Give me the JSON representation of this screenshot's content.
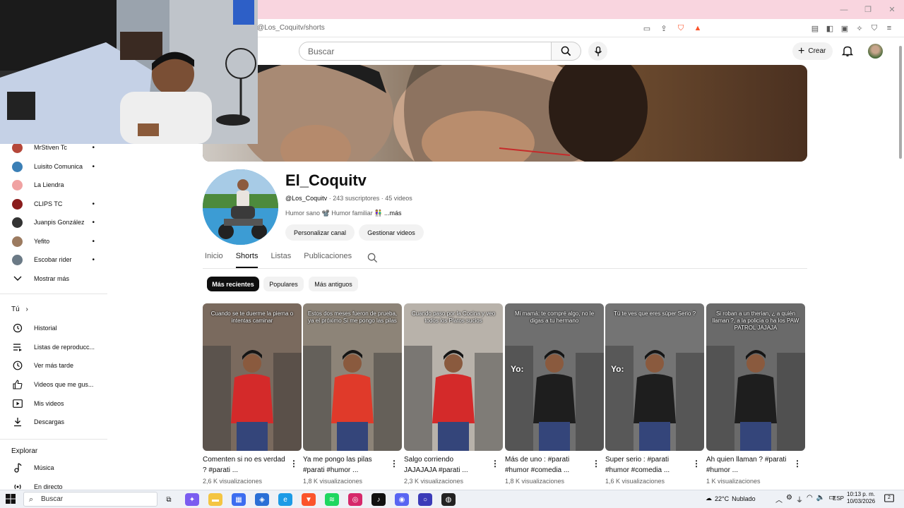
{
  "browser": {
    "url": "@Los_Coquitv/shorts"
  },
  "header": {
    "search_placeholder": "Buscar",
    "create_label": "Crear"
  },
  "sidebar": {
    "subscriptions": [
      {
        "name": "MrStiven Tc",
        "color": "#b5473a",
        "dot": "•"
      },
      {
        "name": "Luisito Comunica",
        "color": "#3b7fb6",
        "dot": "•"
      },
      {
        "name": "La Liendra",
        "color": "#f0a2a2",
        "dot": ""
      },
      {
        "name": "CLIPS TC",
        "color": "#8a1d1d",
        "dot": "•"
      },
      {
        "name": "Juanpis González",
        "color": "#333333",
        "dot": "•"
      },
      {
        "name": "Yefito",
        "color": "#9c7b60",
        "dot": "•"
      },
      {
        "name": "Escobar rider",
        "color": "#6b7a86",
        "dot": "•"
      }
    ],
    "show_more": "Mostrar más",
    "you_label": "Tú",
    "you_items": [
      {
        "label": "Historial",
        "icon": "history-icon"
      },
      {
        "label": "Listas de reproducc...",
        "icon": "playlists-icon"
      },
      {
        "label": "Ver más tarde",
        "icon": "watch-later-icon"
      },
      {
        "label": "Videos que me gus...",
        "icon": "like-icon"
      },
      {
        "label": "Mis videos",
        "icon": "my-videos-icon"
      },
      {
        "label": "Descargas",
        "icon": "download-icon"
      }
    ],
    "explore_label": "Explorar",
    "explore_items": [
      {
        "label": "Música",
        "icon": "music-icon"
      },
      {
        "label": "En directo",
        "icon": "live-icon"
      }
    ]
  },
  "channel": {
    "name": "El_Coquitv",
    "handle": "@Los_Coquitv",
    "subscribers": "243 suscriptores",
    "videos": "45 videos",
    "separator": "·",
    "description": "Humor sano 📽️ Humor familiar 👫",
    "more": "...más",
    "customize_label": "Personalizar canal",
    "manage_label": "Gestionar videos"
  },
  "tabs": [
    "Inicio",
    "Shorts",
    "Listas",
    "Publicaciones"
  ],
  "active_tab": "Shorts",
  "chips": [
    "Más recientes",
    "Populares",
    "Más antiguos"
  ],
  "shorts": [
    {
      "caption": "Cuando se te duerme la pierna o intentas caminar",
      "yo": "",
      "title": "Comenten si no es verdad ? #parati ...",
      "views": "2,6 K visualizaciones",
      "bg": "#7a6a5e",
      "shirt": "#d42a2a"
    },
    {
      "caption": "Estos dos meses fueron de prueba, ya el próximo Si me pongo las pilas",
      "yo": "",
      "title": "Ya me pongo las pilas #parati #humor ...",
      "views": "1,8 K visualizaciones",
      "bg": "#8d8478",
      "shirt": "#e03a2a"
    },
    {
      "caption": "Cuando paso por la Cocina y veo todos los Platos sucios",
      "yo": "",
      "title": "Salgo corriendo JAJAJAJA #parati ...",
      "views": "2,3 K visualizaciones",
      "bg": "#b8b2aa",
      "shirt": "#d42a2a"
    },
    {
      "caption": "Mi mamá: te compré algo, no le digas a tu hermano",
      "yo": "Yo:",
      "title": "Más de uno : #parati #humor #comedia ...",
      "views": "1,8 K visualizaciones",
      "bg": "#6f6f6f",
      "shirt": "#1e1e1e"
    },
    {
      "caption": "Tú te ves que eres súper Serio ?",
      "yo": "Yo:",
      "title": "Super serio : #parati #humor #comedia ...",
      "views": "1,6 K visualizaciones",
      "bg": "#747474",
      "shirt": "#1e1e1e"
    },
    {
      "caption": "Si roban a un therian, ¿ a quién llaman ?, a la policía o ha los PAW PATROL JAJAJA",
      "yo": "",
      "title": "Ah quien llaman ? #parati #humor ...",
      "views": "1 K visualizaciones",
      "bg": "#6a6a6a",
      "shirt": "#1e1e1e"
    }
  ],
  "taskbar": {
    "search_label": "Buscar",
    "temperature": "22°C",
    "weather": "Nublado",
    "language": "ESP",
    "time": "10:13 p. m.",
    "date": "10/03/2026",
    "notifications": "2"
  },
  "colors": {
    "titlebar": "#f9d5df",
    "brave": "#fb542b",
    "chip_active": "#0f0f0f"
  }
}
